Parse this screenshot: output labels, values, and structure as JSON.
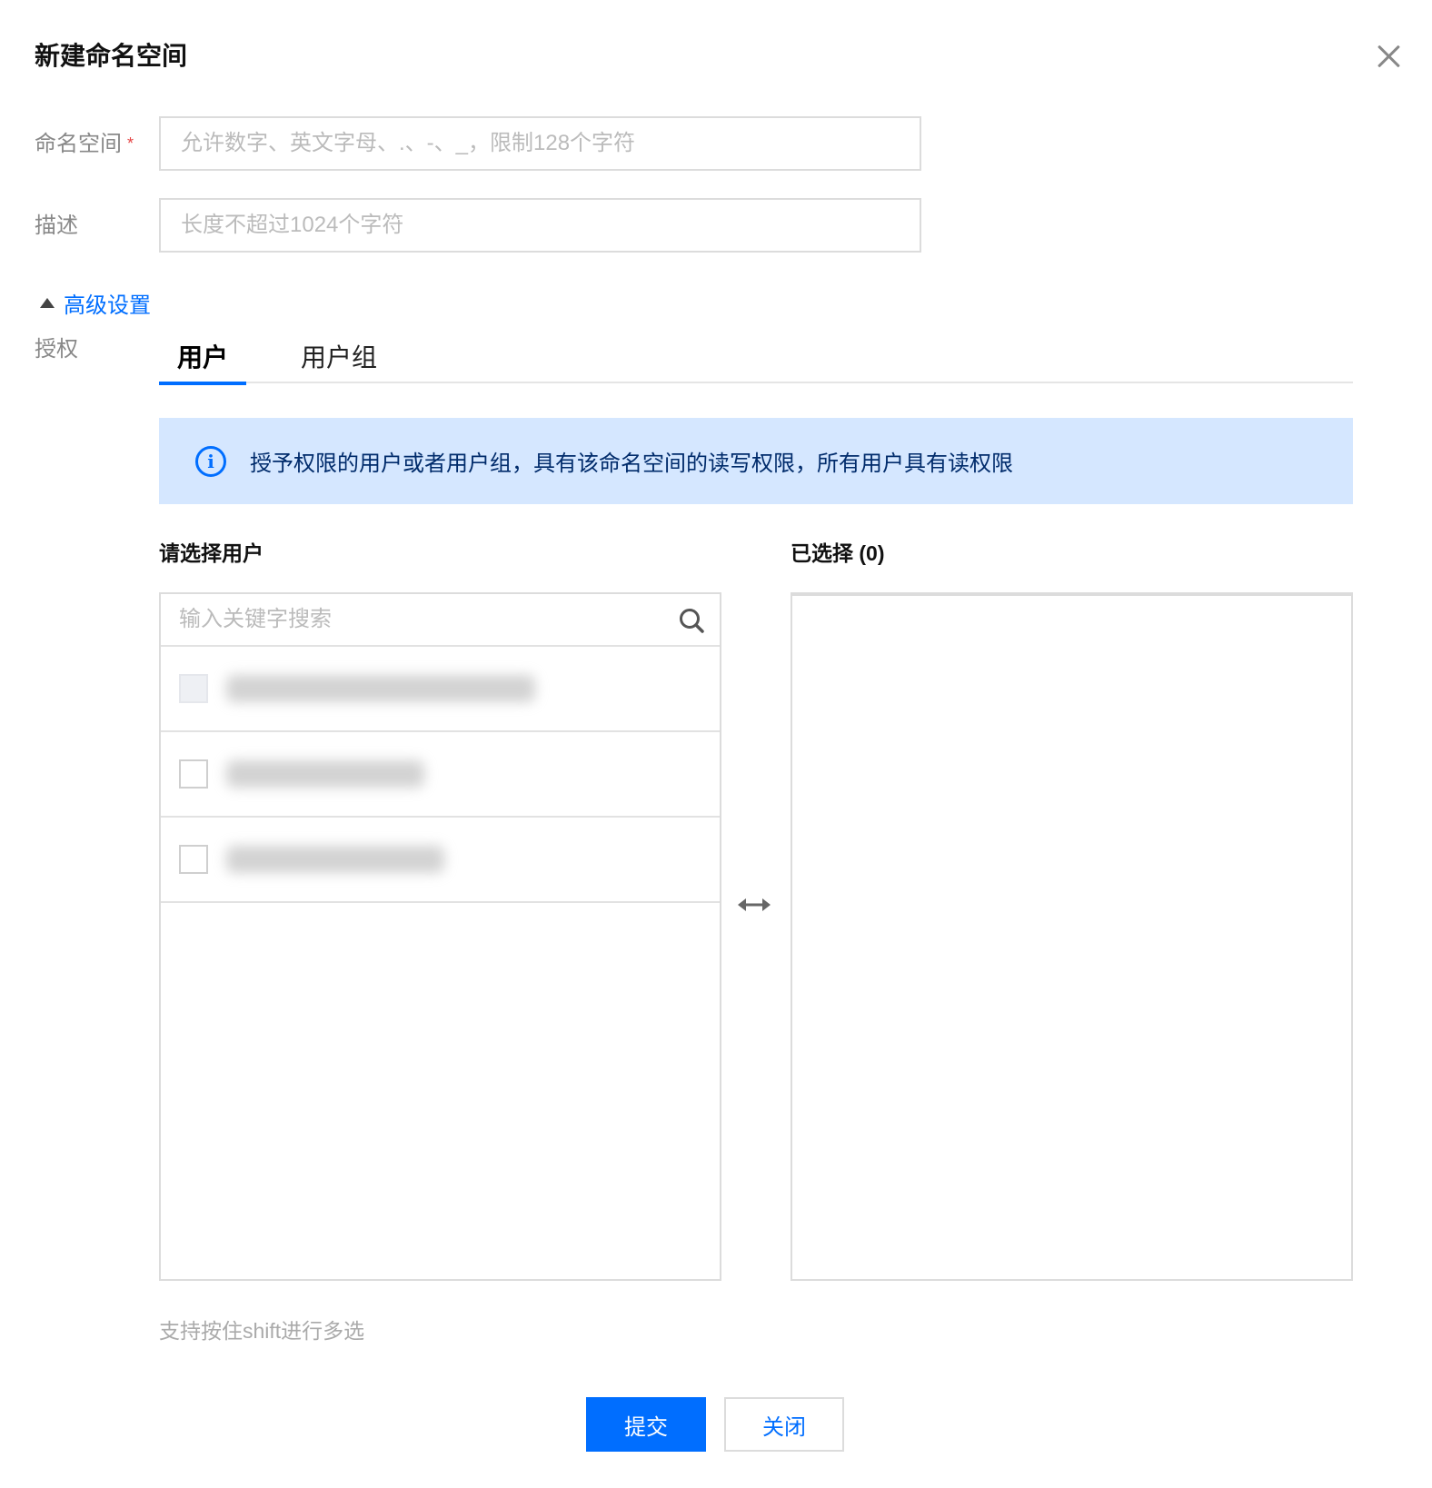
{
  "dialog": {
    "title": "新建命名空间",
    "close_icon": "close-icon"
  },
  "form": {
    "namespace": {
      "label": "命名空间",
      "required_mark": "*",
      "placeholder": "允许数字、英文字母、.、-、_，限制128个字符",
      "value": ""
    },
    "description": {
      "label": "描述",
      "placeholder": "长度不超过1024个字符",
      "value": ""
    }
  },
  "advanced": {
    "toggle_label": "高级设置",
    "expanded": true,
    "auth_label": "授权",
    "tabs": [
      {
        "label": "用户",
        "active": true
      },
      {
        "label": "用户组",
        "active": false
      }
    ],
    "info": "授予权限的用户或者用户组，具有该命名空间的读写权限，所有用户具有读权限",
    "left_title": "请选择用户",
    "right_title": "已选择 (0)",
    "search_placeholder": "输入关键字搜索",
    "user_rows": [
      {
        "disabled": true,
        "checked": false
      },
      {
        "disabled": false,
        "checked": false
      },
      {
        "disabled": false,
        "checked": false
      }
    ],
    "hint": "支持按住shift进行多选"
  },
  "footer": {
    "submit_label": "提交",
    "close_label": "关闭"
  },
  "colors": {
    "primary": "#006eff",
    "banner_bg": "#d5e7ff",
    "required": "#e54545"
  }
}
